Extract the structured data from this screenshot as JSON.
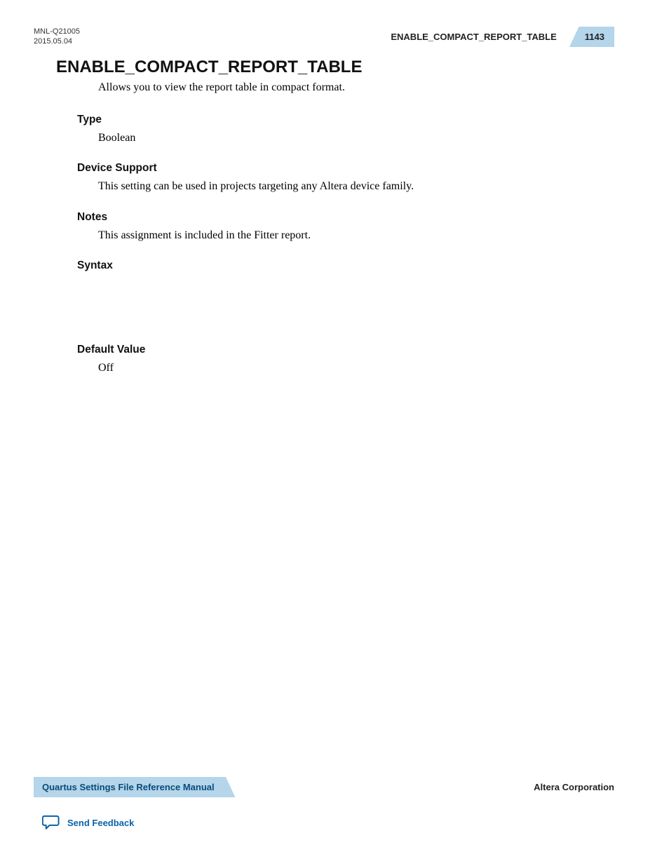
{
  "header": {
    "doc_id": "MNL-Q21005",
    "date": "2015.05.04",
    "running_title": "ENABLE_COMPACT_REPORT_TABLE",
    "page_number": "1143"
  },
  "content": {
    "title": "ENABLE_COMPACT_REPORT_TABLE",
    "description": "Allows you to view the report table in compact format.",
    "sections": {
      "type": {
        "heading": "Type",
        "body": "Boolean"
      },
      "device_support": {
        "heading": "Device Support",
        "body": "This setting can be used in projects targeting any Altera device family."
      },
      "notes": {
        "heading": "Notes",
        "body": "This assignment is included in the Fitter report."
      },
      "syntax": {
        "heading": "Syntax",
        "body": ""
      },
      "default_value": {
        "heading": "Default Value",
        "body": "Off"
      }
    }
  },
  "footer": {
    "manual_title": "Quartus Settings File Reference Manual",
    "corporation": "Altera Corporation",
    "feedback_label": "Send Feedback"
  }
}
